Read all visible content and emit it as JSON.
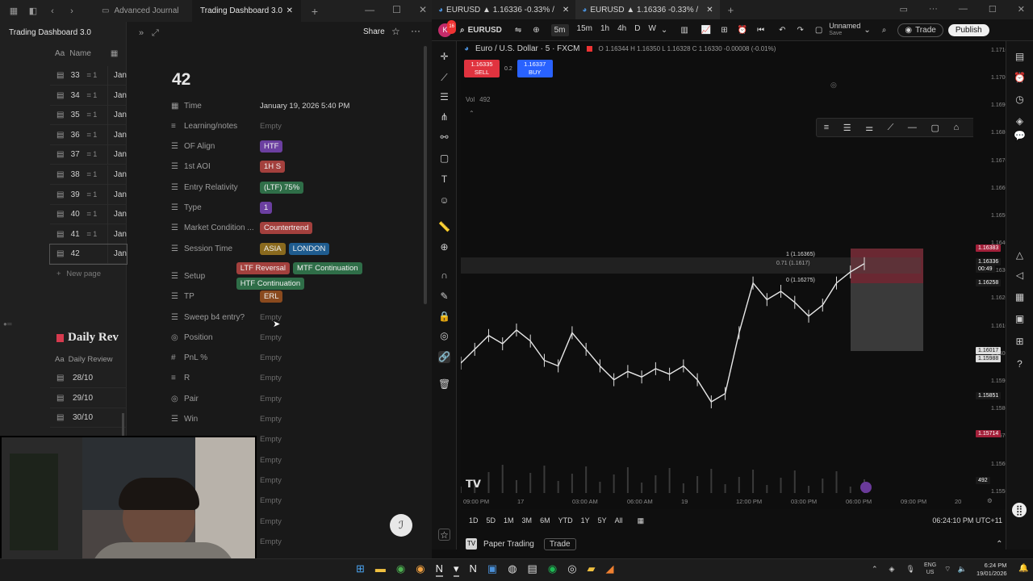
{
  "notion": {
    "tab_back": "Advanced Journal",
    "tab_active": "Trading Dashboard 3.0",
    "sidebar_title": "Trading Dashboard 3.0",
    "col_name": "Name",
    "rows": [
      {
        "num": "33",
        "cmt": "1",
        "date": "Jan"
      },
      {
        "num": "34",
        "cmt": "1",
        "date": "Jan"
      },
      {
        "num": "35",
        "cmt": "1",
        "date": "Jan"
      },
      {
        "num": "36",
        "cmt": "1",
        "date": "Jan"
      },
      {
        "num": "37",
        "cmt": "1",
        "date": "Jan"
      },
      {
        "num": "38",
        "cmt": "1",
        "date": "Jan"
      },
      {
        "num": "39",
        "cmt": "1",
        "date": "Jan"
      },
      {
        "num": "40",
        "cmt": "1",
        "date": "Jan"
      },
      {
        "num": "41",
        "cmt": "1",
        "date": "Jan"
      },
      {
        "num": "42",
        "cmt": "",
        "date": "Jan"
      }
    ],
    "new_page": "New page",
    "daily_review_title": "Daily Rev",
    "daily_review_col": "Daily Review",
    "daily_rows": [
      "28/10",
      "29/10",
      "30/10"
    ],
    "share": "Share",
    "page_title": "42",
    "properties": [
      {
        "label": "Time",
        "value": "January 19, 2026 5:40 PM",
        "icon": "calendar-icon"
      },
      {
        "label": "Learning/notes",
        "value": "Empty",
        "icon": "text-icon"
      },
      {
        "label": "OF Align",
        "tags": [
          {
            "text": "HTF",
            "color": "#6b3fa0"
          }
        ],
        "icon": "list-icon"
      },
      {
        "label": "1st AOI",
        "tags": [
          {
            "text": "1H S",
            "color": "#a3403d"
          }
        ],
        "icon": "list-icon"
      },
      {
        "label": "Entry Relativity",
        "tags": [
          {
            "text": "(LTF) 75%",
            "color": "#2f6e48"
          }
        ],
        "icon": "list-icon"
      },
      {
        "label": "Type",
        "tags": [
          {
            "text": "1",
            "color": "#6b3fa0"
          }
        ],
        "icon": "list-icon"
      },
      {
        "label": "Market Condition ...",
        "tags": [
          {
            "text": "Countertrend",
            "color": "#a3403d"
          }
        ],
        "icon": "list-icon"
      },
      {
        "label": "Session Time",
        "tags": [
          {
            "text": "ASIA",
            "color": "#8a6a1e"
          },
          {
            "text": "LONDON",
            "color": "#1f5c8f"
          }
        ],
        "icon": "list-icon"
      },
      {
        "label": "Setup",
        "tags": [
          {
            "text": "LTF Reversal",
            "color": "#a3403d"
          },
          {
            "text": "MTF Continuation",
            "color": "#2f6e48"
          },
          {
            "text": "HTF Continuation",
            "color": "#2f6e48"
          }
        ],
        "icon": "list-icon"
      },
      {
        "label": "TP",
        "tags": [
          {
            "text": "ERL",
            "color": "#8a4a1e"
          }
        ],
        "icon": "list-icon"
      },
      {
        "label": "Sweep b4 entry?",
        "value": "Empty",
        "icon": "list-icon"
      },
      {
        "label": "Position",
        "value": "Empty",
        "icon": "target-icon"
      },
      {
        "label": "PnL %",
        "value": "Empty",
        "icon": "hash-icon"
      },
      {
        "label": "R",
        "value": "Empty",
        "icon": "text-icon"
      },
      {
        "label": "Pair",
        "value": "Empty",
        "icon": "target-icon"
      },
      {
        "label": "Win",
        "value": "Empty",
        "icon": "list-icon"
      },
      {
        "label": "",
        "value": "Empty",
        "icon": ""
      },
      {
        "label": "",
        "value": "Empty",
        "icon": ""
      },
      {
        "label": "",
        "value": "Empty",
        "icon": ""
      },
      {
        "label": "",
        "value": "Empty",
        "icon": ""
      },
      {
        "label": "",
        "value": "Empty",
        "icon": ""
      },
      {
        "label": "",
        "value": "Empty",
        "icon": ""
      }
    ]
  },
  "tradingview": {
    "tab1": "EURUSD ▲ 1.16336 -0.33% /",
    "tab2": "EURUSD ▲ 1.16336 -0.33% /",
    "symbol": "EURUSD",
    "intervals": [
      "5m",
      "15m",
      "1h",
      "4h",
      "D",
      "W"
    ],
    "layout_name": "Unnamed",
    "layout_sub": "Save",
    "trade_btn": "Trade",
    "publish_btn": "Publish",
    "chart_title": "Euro / U.S. Dollar · 5 · FXCM",
    "ohlc": "O 1.16344 H 1.16350 L 1.16328 C 1.16330 -0.00008 (-0.01%)",
    "sell_price": "1.16335",
    "sell_label": "SELL",
    "spread": "0.2",
    "buy_price": "1.16337",
    "buy_label": "BUY",
    "vol_label": "Vol",
    "vol_value": "492",
    "price_ticks": [
      "1.17100",
      "1.17000",
      "1.16900",
      "1.16800",
      "1.16700",
      "1.16600",
      "1.16500",
      "1.16400",
      "1.16300",
      "1.16200",
      "1.16100",
      "1.16000",
      "1.15900",
      "1.15800",
      "1.15700",
      "1.15600",
      "1.15500"
    ],
    "price_ticks_y": [
      63,
      97,
      131,
      165,
      200,
      234,
      268,
      302,
      336,
      370,
      405,
      439,
      473,
      507,
      541,
      576,
      610
    ],
    "price_tags": [
      {
        "text": "1.16383",
        "bg": "#a3203a",
        "y": 308
      },
      {
        "text": "1.16336",
        "bg": "#1a1a1a",
        "y": 325
      },
      {
        "text": "00:49",
        "bg": "#1a1a1a",
        "y": 334
      },
      {
        "text": "1.16258",
        "bg": "#1a1a1a",
        "y": 351
      },
      {
        "text": "1.16017",
        "bg": "#dddddd",
        "y": 435
      },
      {
        "text": "1.15988",
        "bg": "#dddddd",
        "y": 445
      },
      {
        "text": "1.15851",
        "bg": "#1a1a1a",
        "y": 491
      },
      {
        "text": "1.15714",
        "bg": "#a3203a",
        "y": 538
      },
      {
        "text": "492",
        "bg": "#1a1a1a",
        "y": 596
      }
    ],
    "pos_labels": [
      "1 (1.16365)",
      "0.71 (1.1617)",
      "0 (1.16275)"
    ],
    "time_ticks": [
      "09:00 PM",
      "17",
      "03:00 AM",
      "06:00 AM",
      "19",
      "12:00 PM",
      "03:00 PM",
      "06:00 PM",
      "09:00 PM",
      "20"
    ],
    "time_ticks_x": [
      588,
      655,
      723,
      791,
      858,
      926,
      994,
      1062,
      1130,
      1197
    ],
    "ranges": [
      "1D",
      "5D",
      "1M",
      "3M",
      "6M",
      "YTD",
      "1Y",
      "5Y",
      "All"
    ],
    "clock": "06:24:10 PM UTC+11",
    "paper_trading": "Paper Trading",
    "trade_tab": "Trade"
  },
  "taskbar": {
    "lang": "ENG",
    "region": "US",
    "time": "6:24 PM",
    "date": "19/01/2026"
  },
  "chart_data": {
    "type": "line",
    "title": "Euro / U.S. Dollar · 5 · FXCM",
    "x": [
      "09:00 PM",
      "17",
      "03:00 AM",
      "06:00 AM",
      "19",
      "12:00 PM",
      "03:00 PM",
      "06:00 PM",
      "09:00 PM",
      "20"
    ],
    "y_min": 1.155,
    "y_max": 1.171,
    "series": [
      {
        "values": [
          1.1597,
          1.1602,
          1.1607,
          1.1604,
          1.1609,
          1.1605,
          1.1598,
          1.1596,
          1.1608,
          1.1602,
          1.1596,
          1.1591,
          1.1594,
          1.1592,
          1.1595,
          1.1593,
          1.1596,
          1.1591,
          1.1583,
          1.1586,
          1.1608,
          1.1626,
          1.162,
          1.1623,
          1.1619,
          1.1614,
          1.1618,
          1.1626,
          1.163,
          1.1633
        ]
      }
    ]
  }
}
